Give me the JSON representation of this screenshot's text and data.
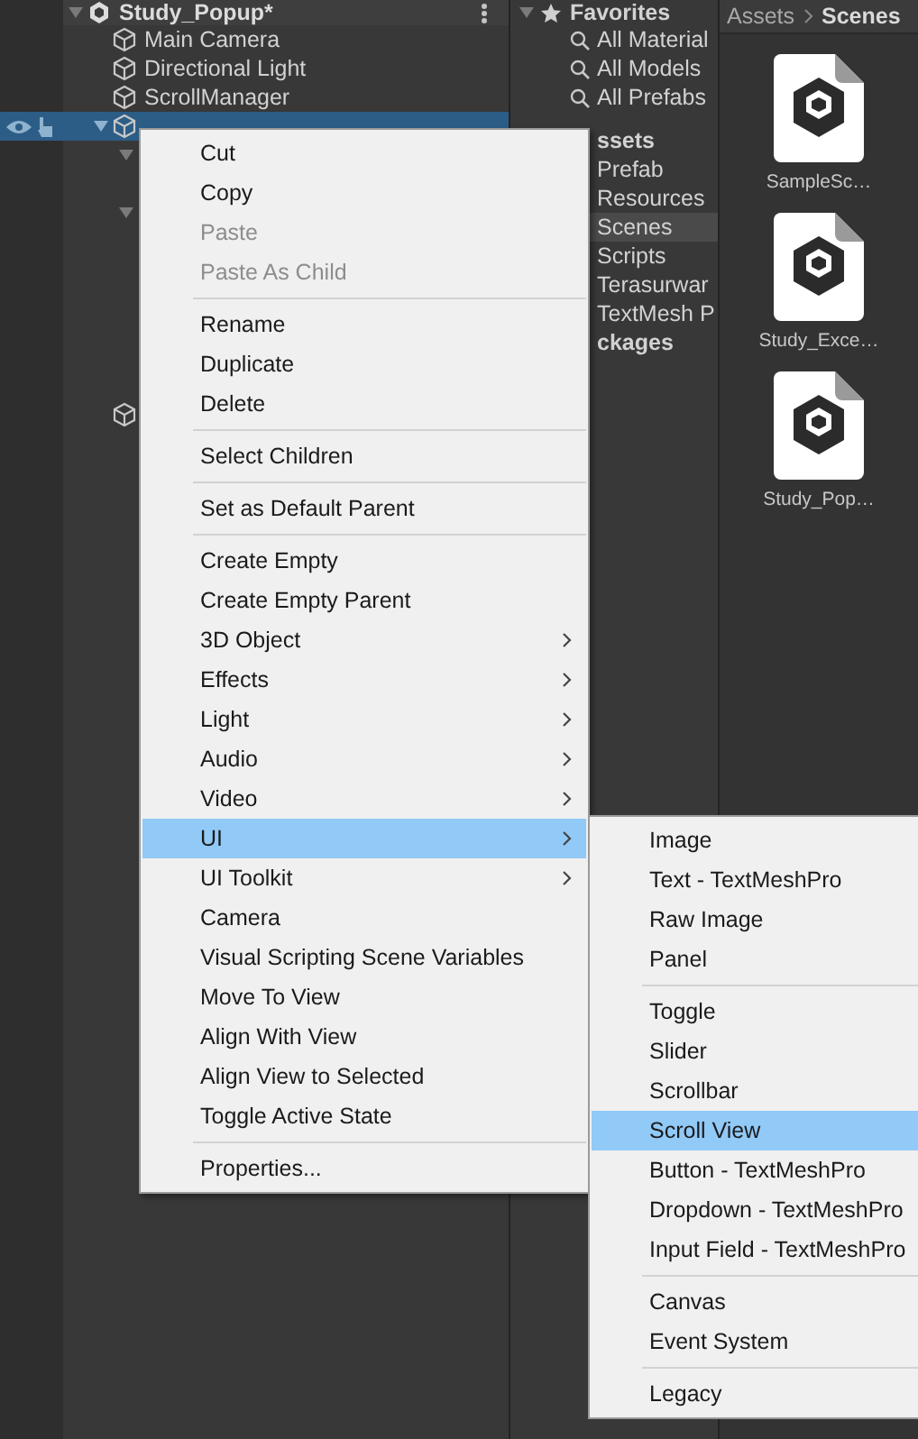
{
  "hierarchy": {
    "scene": {
      "label": "Study_Popup*"
    },
    "items": [
      {
        "label": "Main Camera",
        "selected": false
      },
      {
        "label": "Directional Light",
        "selected": false
      },
      {
        "label": "ScrollManager",
        "selected": false
      },
      {
        "selected": true
      }
    ]
  },
  "project": {
    "favorites": {
      "label": "Favorites",
      "items": [
        "All Material",
        "All Models",
        "All Prefabs"
      ]
    },
    "folders": [
      {
        "label": "ssets",
        "kind": "heading",
        "selected": false
      },
      {
        "label": "Prefab",
        "kind": "folder",
        "selected": false
      },
      {
        "label": "Resources",
        "kind": "folder",
        "selected": false
      },
      {
        "label": "Scenes",
        "kind": "folder",
        "selected": true
      },
      {
        "label": "Scripts",
        "kind": "folder",
        "selected": false
      },
      {
        "label": "Terasurwar",
        "kind": "folder",
        "selected": false
      },
      {
        "label": "TextMesh P",
        "kind": "folder",
        "selected": false
      },
      {
        "label": "ckages",
        "kind": "heading",
        "selected": false
      }
    ]
  },
  "assets": {
    "breadcrumb": [
      "Assets",
      "Scenes"
    ],
    "files": [
      "SampleSc…",
      "Study_Exce…",
      "Study_Pop…"
    ]
  },
  "context_menu": {
    "groups": [
      [
        {
          "label": "Cut",
          "disabled": false,
          "submenu": false,
          "selected": false
        },
        {
          "label": "Copy",
          "disabled": false,
          "submenu": false,
          "selected": false
        },
        {
          "label": "Paste",
          "disabled": true,
          "submenu": false,
          "selected": false
        },
        {
          "label": "Paste As Child",
          "disabled": true,
          "submenu": false,
          "selected": false
        }
      ],
      [
        {
          "label": "Rename",
          "disabled": false,
          "submenu": false,
          "selected": false
        },
        {
          "label": "Duplicate",
          "disabled": false,
          "submenu": false,
          "selected": false
        },
        {
          "label": "Delete",
          "disabled": false,
          "submenu": false,
          "selected": false
        }
      ],
      [
        {
          "label": "Select Children",
          "disabled": false,
          "submenu": false,
          "selected": false
        }
      ],
      [
        {
          "label": "Set as Default Parent",
          "disabled": false,
          "submenu": false,
          "selected": false
        }
      ],
      [
        {
          "label": "Create Empty",
          "disabled": false,
          "submenu": false,
          "selected": false
        },
        {
          "label": "Create Empty Parent",
          "disabled": false,
          "submenu": false,
          "selected": false
        },
        {
          "label": "3D Object",
          "disabled": false,
          "submenu": true,
          "selected": false
        },
        {
          "label": "Effects",
          "disabled": false,
          "submenu": true,
          "selected": false
        },
        {
          "label": "Light",
          "disabled": false,
          "submenu": true,
          "selected": false
        },
        {
          "label": "Audio",
          "disabled": false,
          "submenu": true,
          "selected": false
        },
        {
          "label": "Video",
          "disabled": false,
          "submenu": true,
          "selected": false
        },
        {
          "label": "UI",
          "disabled": false,
          "submenu": true,
          "selected": true
        },
        {
          "label": "UI Toolkit",
          "disabled": false,
          "submenu": true,
          "selected": false
        },
        {
          "label": "Camera",
          "disabled": false,
          "submenu": false,
          "selected": false
        },
        {
          "label": "Visual Scripting Scene Variables",
          "disabled": false,
          "submenu": false,
          "selected": false
        },
        {
          "label": "Move To View",
          "disabled": false,
          "submenu": false,
          "selected": false
        },
        {
          "label": "Align With View",
          "disabled": false,
          "submenu": false,
          "selected": false
        },
        {
          "label": "Align View to Selected",
          "disabled": false,
          "submenu": false,
          "selected": false
        },
        {
          "label": "Toggle Active State",
          "disabled": false,
          "submenu": false,
          "selected": false
        }
      ],
      [
        {
          "label": "Properties...",
          "disabled": false,
          "submenu": false,
          "selected": false
        }
      ]
    ]
  },
  "submenu": {
    "groups": [
      [
        {
          "label": "Image",
          "selected": false
        },
        {
          "label": "Text - TextMeshPro",
          "selected": false
        },
        {
          "label": "Raw Image",
          "selected": false
        },
        {
          "label": "Panel",
          "selected": false
        }
      ],
      [
        {
          "label": "Toggle",
          "selected": false
        },
        {
          "label": "Slider",
          "selected": false
        },
        {
          "label": "Scrollbar",
          "selected": false
        },
        {
          "label": "Scroll View",
          "selected": true
        },
        {
          "label": "Button - TextMeshPro",
          "selected": false
        },
        {
          "label": "Dropdown - TextMeshPro",
          "selected": false
        },
        {
          "label": "Input Field - TextMeshPro",
          "selected": false
        }
      ],
      [
        {
          "label": "Canvas",
          "selected": false
        },
        {
          "label": "Event System",
          "selected": false
        }
      ],
      [
        {
          "label": "Legacy",
          "selected": false
        }
      ]
    ]
  }
}
